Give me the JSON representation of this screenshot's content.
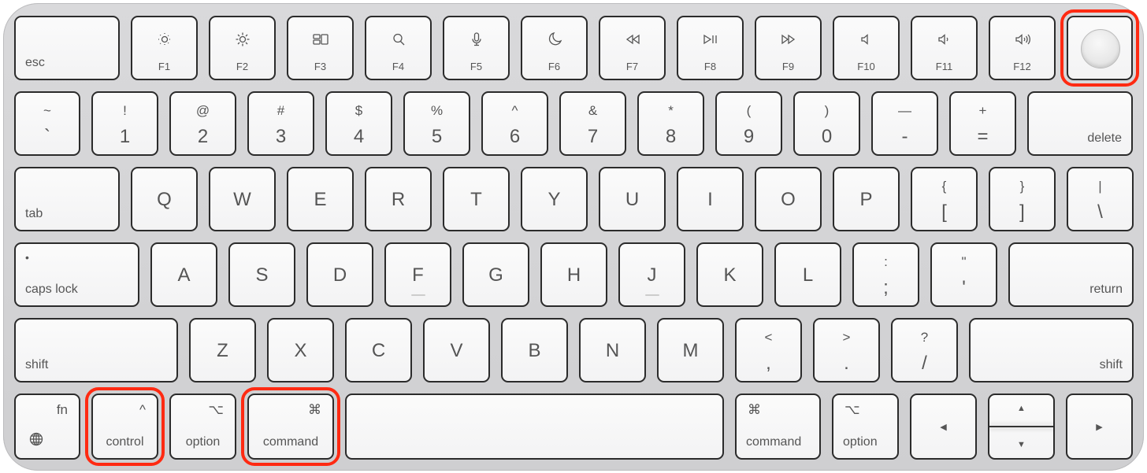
{
  "highlight_color": "#ff2a12",
  "rows": [
    [
      {
        "id": "esc",
        "bottom": "esc"
      },
      {
        "id": "f1",
        "label": "F1",
        "icon": "brightness-down"
      },
      {
        "id": "f2",
        "label": "F2",
        "icon": "brightness-up"
      },
      {
        "id": "f3",
        "label": "F3",
        "icon": "mission-control"
      },
      {
        "id": "f4",
        "label": "F4",
        "icon": "search"
      },
      {
        "id": "f5",
        "label": "F5",
        "icon": "microphone"
      },
      {
        "id": "f6",
        "label": "F6",
        "icon": "moon"
      },
      {
        "id": "f7",
        "label": "F7",
        "icon": "rewind"
      },
      {
        "id": "f8",
        "label": "F8",
        "icon": "play-pause"
      },
      {
        "id": "f9",
        "label": "F9",
        "icon": "fast-forward"
      },
      {
        "id": "f10",
        "label": "F10",
        "icon": "speaker-mute"
      },
      {
        "id": "f11",
        "label": "F11",
        "icon": "volume-down"
      },
      {
        "id": "f12",
        "label": "F12",
        "icon": "volume-up"
      },
      {
        "id": "touch-id",
        "icon": "touch-id",
        "highlighted": true
      }
    ],
    [
      {
        "id": "backtick",
        "top": "~",
        "bottom": "`"
      },
      {
        "id": "1",
        "top": "!",
        "bottom": "1"
      },
      {
        "id": "2",
        "top": "@",
        "bottom": "2"
      },
      {
        "id": "3",
        "top": "#",
        "bottom": "3"
      },
      {
        "id": "4",
        "top": "$",
        "bottom": "4"
      },
      {
        "id": "5",
        "top": "%",
        "bottom": "5"
      },
      {
        "id": "6",
        "top": "^",
        "bottom": "6"
      },
      {
        "id": "7",
        "top": "&",
        "bottom": "7"
      },
      {
        "id": "8",
        "top": "*",
        "bottom": "8"
      },
      {
        "id": "9",
        "top": "(",
        "bottom": "9"
      },
      {
        "id": "0",
        "top": ")",
        "bottom": "0"
      },
      {
        "id": "minus",
        "top": "—",
        "bottom": "-"
      },
      {
        "id": "equals",
        "top": "+",
        "bottom": "="
      },
      {
        "id": "delete",
        "bottom": "delete"
      }
    ],
    [
      {
        "id": "tab",
        "bottom": "tab"
      },
      {
        "id": "q",
        "center": "Q"
      },
      {
        "id": "w",
        "center": "W"
      },
      {
        "id": "e",
        "center": "E"
      },
      {
        "id": "r",
        "center": "R"
      },
      {
        "id": "t",
        "center": "T"
      },
      {
        "id": "y",
        "center": "Y"
      },
      {
        "id": "u",
        "center": "U"
      },
      {
        "id": "i",
        "center": "I"
      },
      {
        "id": "o",
        "center": "O"
      },
      {
        "id": "p",
        "center": "P"
      },
      {
        "id": "lbracket",
        "top": "{",
        "bottom": "["
      },
      {
        "id": "rbracket",
        "top": "}",
        "bottom": "]"
      },
      {
        "id": "backslash",
        "top": "|",
        "bottom": "\\"
      }
    ],
    [
      {
        "id": "caps-lock",
        "bottom": "caps lock",
        "indicator": "•"
      },
      {
        "id": "a",
        "center": "A"
      },
      {
        "id": "s",
        "center": "S"
      },
      {
        "id": "d",
        "center": "D"
      },
      {
        "id": "f",
        "center": "F"
      },
      {
        "id": "g",
        "center": "G"
      },
      {
        "id": "h",
        "center": "H"
      },
      {
        "id": "j",
        "center": "J"
      },
      {
        "id": "k",
        "center": "K"
      },
      {
        "id": "l",
        "center": "L"
      },
      {
        "id": "semicolon",
        "top": ":",
        "bottom": ";"
      },
      {
        "id": "quote",
        "top": "\"",
        "bottom": "'"
      },
      {
        "id": "return",
        "bottom": "return"
      }
    ],
    [
      {
        "id": "shift-left",
        "bottom": "shift"
      },
      {
        "id": "z",
        "center": "Z"
      },
      {
        "id": "x",
        "center": "X"
      },
      {
        "id": "c",
        "center": "C"
      },
      {
        "id": "v",
        "center": "V"
      },
      {
        "id": "b",
        "center": "B"
      },
      {
        "id": "n",
        "center": "N"
      },
      {
        "id": "m",
        "center": "M"
      },
      {
        "id": "comma",
        "top": "<",
        "bottom": ","
      },
      {
        "id": "period",
        "top": ">",
        "bottom": "."
      },
      {
        "id": "slash",
        "top": "?",
        "bottom": "/"
      },
      {
        "id": "shift-right",
        "bottom": "shift"
      }
    ],
    [
      {
        "id": "fn",
        "top": "fn",
        "icon": "globe"
      },
      {
        "id": "control",
        "top": "^",
        "bottom": "control",
        "highlighted": true
      },
      {
        "id": "option-left",
        "top": "⌥",
        "bottom": "option"
      },
      {
        "id": "command-left",
        "top": "⌘",
        "bottom": "command",
        "highlighted": true
      },
      {
        "id": "space"
      },
      {
        "id": "command-right",
        "top": "⌘",
        "bottom": "command"
      },
      {
        "id": "option-right",
        "top": "⌥",
        "bottom": "option"
      },
      {
        "id": "arrow-left",
        "center": "◀"
      },
      {
        "id": "arrow-up-down",
        "top": "▲",
        "bottom": "▼"
      },
      {
        "id": "arrow-right",
        "center": "▶"
      }
    ]
  ]
}
